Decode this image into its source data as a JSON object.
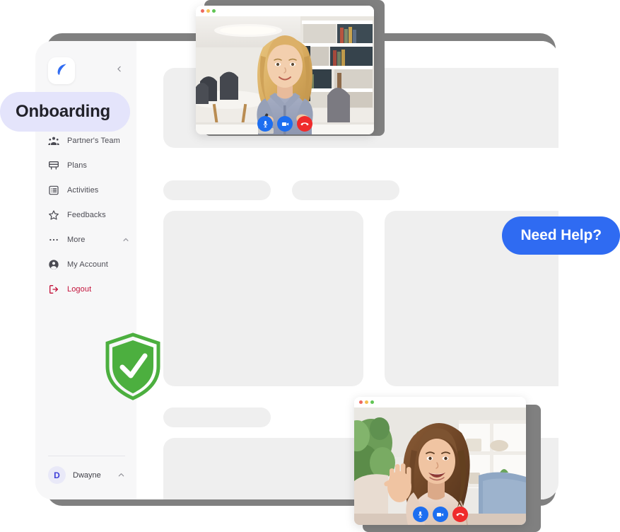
{
  "app": {
    "logo_icon": "leaf-logo-icon",
    "collapse_icon": "chevron-left-icon"
  },
  "sidebar": {
    "items": [
      {
        "label": "",
        "icon": "hidden-item-icon",
        "hidden_behind_badge": true
      },
      {
        "label": "Partner's Team",
        "icon": "people-group-icon"
      },
      {
        "label": "Plans",
        "icon": "monitor-icon"
      },
      {
        "label": "Activities",
        "icon": "list-icon"
      },
      {
        "label": "Feedbacks",
        "icon": "star-icon"
      },
      {
        "label": "More",
        "icon": "ellipsis-icon",
        "trailing_icon": "chevron-up-icon"
      },
      {
        "label": "My Account",
        "icon": "user-circle-icon"
      },
      {
        "label": "Logout",
        "icon": "logout-icon",
        "danger": true
      }
    ],
    "profile": {
      "avatar_initial": "D",
      "name": "Dwayne",
      "chevron_icon": "chevron-up-icon"
    }
  },
  "badges": {
    "onboarding": {
      "label": "Onboarding",
      "bg": "#e4e4fb",
      "fg": "#22222a"
    },
    "need_help": {
      "label": "Need Help?",
      "bg": "#2f6bf2",
      "fg": "#ffffff"
    },
    "security_shield": {
      "icon": "shield-check-icon",
      "color": "#4caf3f"
    }
  },
  "main": {
    "skeleton": {
      "hero": "placeholder-block",
      "pill_left": "placeholder-pill",
      "pill_right": "placeholder-pill",
      "card_left": "placeholder-card",
      "card_right": "placeholder-card",
      "pill_bottom": "placeholder-pill",
      "block_bottom": "placeholder-block"
    }
  },
  "video_calls": [
    {
      "id": "top",
      "window_dots": [
        "red",
        "yellow",
        "green"
      ],
      "scene": "Woman with long blonde hair in a light blue-grey shirt, seated at a white table in a bright office library with bookshelves and grey chairs",
      "controls": [
        {
          "name": "microphone",
          "icon": "microphone-icon",
          "color": "#1d6ef0"
        },
        {
          "name": "camera",
          "icon": "video-camera-icon",
          "color": "#1d6ef0"
        },
        {
          "name": "end-call",
          "icon": "phone-hangup-icon",
          "color": "#ef2b2b"
        }
      ]
    },
    {
      "id": "bottom",
      "window_dots": [
        "red",
        "yellow",
        "green"
      ],
      "scene": "Smiling woman with wavy brown hair in a beige top waving her hand, in a living room with plants, white shelving and a blue couch",
      "controls": [
        {
          "name": "microphone",
          "icon": "microphone-icon",
          "color": "#1d6ef0"
        },
        {
          "name": "camera",
          "icon": "video-camera-icon",
          "color": "#1d6ef0"
        },
        {
          "name": "end-call",
          "icon": "phone-hangup-icon",
          "color": "#ef2b2b"
        }
      ]
    }
  ]
}
